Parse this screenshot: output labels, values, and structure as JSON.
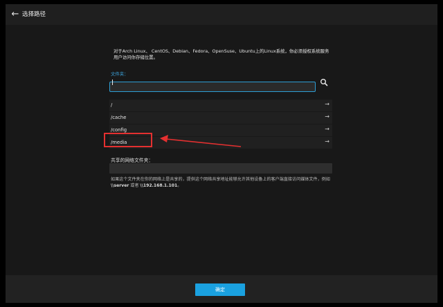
{
  "header": {
    "title": "选择路径"
  },
  "description": "对于Arch Linux、 CentOS、Debian、Fedora、OpenSuse、Ubuntu上的Linux系统，你必须授权系统服务用户访问你存储位置。",
  "folder": {
    "label": "文件夹：",
    "value": ""
  },
  "folders": [
    {
      "label": "/"
    },
    {
      "label": "/cache"
    },
    {
      "label": "/config"
    },
    {
      "label": "/media"
    }
  ],
  "shared": {
    "label": "共享的网络文件夹：",
    "value": "",
    "hint_prefix": "如果这个文件夹在你的网络上是共享的，提供这个网络共享地址能够允许其他设备上的客户端直接访问媒体文件，例如",
    "hint_example1": "\\\\server",
    "hint_or": "或者",
    "hint_example2": "\\\\192.168.1.101",
    "hint_suffix": "。"
  },
  "footer": {
    "ok_label": "确定"
  },
  "colors": {
    "accent": "#1aa1e0",
    "annotation": "#e53030"
  },
  "icons": {
    "back": "arrow-left-icon",
    "search": "search-icon",
    "chevron": "arrow-right-icon"
  }
}
